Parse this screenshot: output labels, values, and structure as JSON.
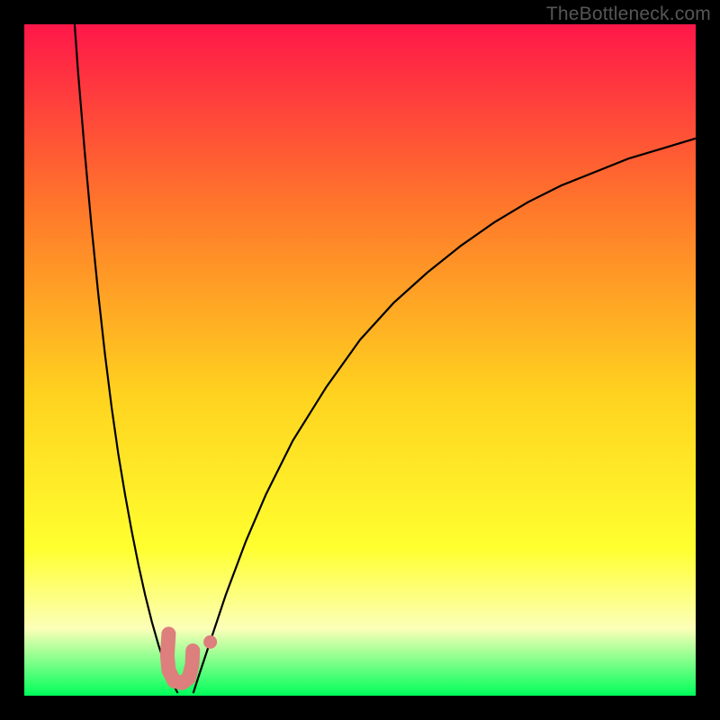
{
  "attribution": "TheBottleneck.com",
  "colors": {
    "frame": "#000000",
    "gradient_top": "#ff1749",
    "gradient_mid_upper": "#ff7a2a",
    "gradient_mid": "#ffd21f",
    "gradient_mid_lower": "#ffff2f",
    "gradient_pale": "#fcffb8",
    "gradient_bottom": "#00ff5a",
    "curve": "#000000",
    "marker": "#dd7f7c"
  },
  "chart_data": {
    "type": "line",
    "title": "",
    "xlabel": "",
    "ylabel": "",
    "xlim": [
      0,
      100
    ],
    "ylim": [
      0,
      100
    ],
    "series": [
      {
        "name": "left-branch",
        "x": [
          7.5,
          8,
          9,
          10,
          11,
          12,
          13,
          14,
          15,
          16,
          17,
          18,
          19,
          20,
          21,
          22,
          22.8
        ],
        "y": [
          100,
          93,
          81,
          70,
          60,
          51,
          43,
          36,
          30,
          24.5,
          19.5,
          15,
          11,
          7.5,
          4.5,
          2,
          0.5
        ]
      },
      {
        "name": "right-branch",
        "x": [
          25.2,
          26,
          28,
          30,
          33,
          36,
          40,
          45,
          50,
          55,
          60,
          65,
          70,
          75,
          80,
          85,
          90,
          95,
          100
        ],
        "y": [
          0.5,
          3,
          9,
          15,
          23,
          30,
          38,
          46,
          53,
          58.5,
          63,
          67,
          70.5,
          73.5,
          76,
          78,
          80,
          81.5,
          83
        ]
      }
    ],
    "markers": [
      {
        "name": "marker-stroke-1",
        "path_x": [
          21.5,
          21.3,
          21.5,
          22.3,
          23.5,
          24.5,
          25.0,
          25.1
        ],
        "path_y": [
          9.2,
          6.0,
          3.8,
          2.2,
          1.9,
          2.6,
          4.6,
          6.7
        ]
      },
      {
        "name": "marker-dot-2",
        "x": 27.7,
        "y": 8.0
      }
    ]
  }
}
